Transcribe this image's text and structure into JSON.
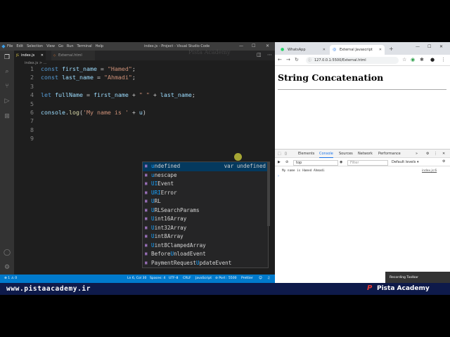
{
  "vscode": {
    "menu": [
      "File",
      "Edit",
      "Selection",
      "View",
      "Go",
      "Run",
      "Terminal",
      "Help"
    ],
    "window_title": "index.js - Project - Visual Studio Code",
    "tabs": [
      {
        "label": "index.js",
        "active": true
      },
      {
        "label": "External.html",
        "active": false
      }
    ],
    "breadcrumb": "index.js > ...",
    "lines": [
      {
        "n": "1",
        "parts": [
          [
            "kw",
            "const "
          ],
          [
            "id",
            "first_name"
          ],
          [
            "op",
            " = "
          ],
          [
            "str",
            "\"Hamed\""
          ],
          [
            "op",
            ";"
          ]
        ]
      },
      {
        "n": "2",
        "parts": [
          [
            "kw",
            "const "
          ],
          [
            "id",
            "last_name"
          ],
          [
            "op",
            " = "
          ],
          [
            "str",
            "\"Ahmadi\""
          ],
          [
            "op",
            ";"
          ]
        ]
      },
      {
        "n": "3",
        "parts": []
      },
      {
        "n": "4",
        "parts": [
          [
            "kw",
            "let "
          ],
          [
            "id",
            "fullName"
          ],
          [
            "op",
            " = "
          ],
          [
            "id",
            "first_name"
          ],
          [
            "op",
            " + "
          ],
          [
            "str",
            "\" \""
          ],
          [
            "op",
            " + "
          ],
          [
            "id",
            "last_name"
          ],
          [
            "op",
            ";"
          ]
        ]
      },
      {
        "n": "5",
        "parts": []
      },
      {
        "n": "6",
        "parts": [
          [
            "id",
            "console"
          ],
          [
            "op",
            "."
          ],
          [
            "fn",
            "log"
          ],
          [
            "op",
            "("
          ],
          [
            "str",
            "'My name is '"
          ],
          [
            "op",
            " + "
          ],
          [
            "id",
            "u"
          ],
          [
            "op",
            ")"
          ]
        ]
      },
      {
        "n": "7",
        "parts": []
      },
      {
        "n": "8",
        "parts": []
      },
      {
        "n": "9",
        "parts": []
      }
    ],
    "suggestions": [
      {
        "hl": "u",
        "rest": "ndefined",
        "detail": "var undefined",
        "selected": true
      },
      {
        "hl": "u",
        "rest": "nescape",
        "detail": ""
      },
      {
        "pre": "",
        "hl": "UI",
        "rest": "Event",
        "detail": ""
      },
      {
        "hl": "URI",
        "rest": "Error",
        "detail": ""
      },
      {
        "hl": "U",
        "rest": "RL",
        "detail": ""
      },
      {
        "hl": "U",
        "rest": "RLSearchParams",
        "detail": ""
      },
      {
        "hl": "U",
        "rest": "int16Array",
        "detail": ""
      },
      {
        "hl": "U",
        "rest": "int32Array",
        "detail": ""
      },
      {
        "hl": "U",
        "rest": "int8Array",
        "detail": ""
      },
      {
        "hl": "U",
        "rest": "int8ClampedArray",
        "detail": ""
      },
      {
        "pre": "Before",
        "hl": "U",
        "rest": "nloadEvent",
        "detail": ""
      },
      {
        "pre": "PaymentRequest",
        "hl": "U",
        "rest": "pdateEvent",
        "detail": ""
      }
    ],
    "status": {
      "errors": "⊗ 1 ⚠ 0",
      "position": "Ln 6, Col 30",
      "spaces": "Spaces: 4",
      "encoding": "UTF-8",
      "eol": "CRLF",
      "language": "JavaScript",
      "port": "⊘ Port : 5500",
      "prettier": "Prettier"
    }
  },
  "browser": {
    "tabs": [
      {
        "label": "WhatsApp",
        "active": false
      },
      {
        "label": "External Javascript",
        "active": true
      }
    ],
    "url": "127.0.0.1:5500/External.html",
    "heading": "String Concatenation",
    "devtools": {
      "tabs": [
        "Elements",
        "Console",
        "Sources",
        "Network",
        "Performance",
        "»"
      ],
      "context": "top",
      "filter_placeholder": "Filter",
      "levels": "Default levels ▾",
      "log_text": "My name is Hamed Ahmadi",
      "log_source": "index.js:6"
    },
    "recording": "Recording Toolbar"
  },
  "footer": {
    "site": "www.pistaacademy.ir",
    "brand": "Pista Academy",
    "watermark": "Pista Academy"
  },
  "colors": {
    "editor_bg": "#1e1e1e",
    "statusbar": "#007acc",
    "footer": "#0e1a4a",
    "suggest_selected": "#04395e"
  }
}
